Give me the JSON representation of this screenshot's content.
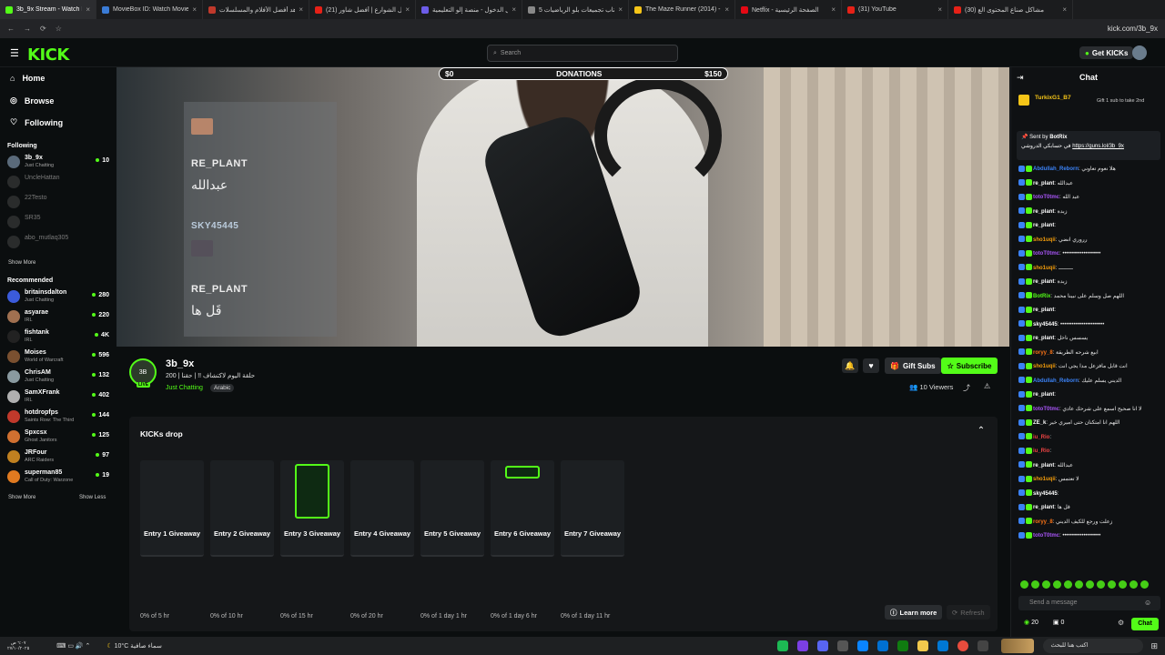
{
  "browser": {
    "tabs": [
      {
        "label": "3b_9x Stream - Watch Live on",
        "color": "#53fc18",
        "active": true
      },
      {
        "label": "MovieBox ID: Watch Movies",
        "color": "#3a7bd5"
      },
      {
        "label": "شاهد أفضل الأفلام والمسلسلات",
        "color": "#c0392b"
      },
      {
        "label": "(21) أكل الشوارع | أفضل شاور",
        "color": "#e62117"
      },
      {
        "label": "تسجيل الدخول - منصة إلو التعليمية",
        "color": "#6c5ce7"
      },
      {
        "label": "كتاب تجميعات بلو الرياضيات 5",
        "color": "#888888"
      },
      {
        "label": "The Maze Runner (2014) - IMDb",
        "color": "#f5c518"
      },
      {
        "label": "Netflix - الصفحة الرئيسية",
        "color": "#e50914"
      },
      {
        "label": "(31) YouTube",
        "color": "#e62117"
      },
      {
        "label": "(30) مشاكل صناع المحتوى الع",
        "color": "#e62117"
      }
    ],
    "url": "kick.com/3b_9x"
  },
  "header": {
    "logo": "KICK",
    "search_placeholder": "Search",
    "get_kicks": "Get KICKs"
  },
  "sidebar": {
    "nav": [
      {
        "label": "Home",
        "icon": "home-icon"
      },
      {
        "label": "Browse",
        "icon": "compass-icon"
      },
      {
        "label": "Following",
        "icon": "heart-icon"
      }
    ],
    "following_title": "Following",
    "following": [
      {
        "name": "3b_9x",
        "category": "Just Chatting",
        "viewers": "10",
        "live": true,
        "color": "#5a6a7a"
      },
      {
        "name": "UncleHattan",
        "category": "",
        "viewers": "",
        "live": false,
        "color": "#4a4a4a"
      },
      {
        "name": "22Testo",
        "category": "",
        "viewers": "",
        "live": false,
        "color": "#4a4a4a"
      },
      {
        "name": "SR35",
        "category": "",
        "viewers": "",
        "live": false,
        "color": "#4a4a4a"
      },
      {
        "name": "abo_mutlaq305",
        "category": "",
        "viewers": "",
        "live": false,
        "color": "#4a4a4a"
      }
    ],
    "show_more": "Show More",
    "recommended_title": "Recommended",
    "recommended": [
      {
        "name": "britainsdalton",
        "category": "Just Chatting",
        "viewers": "280",
        "color": "#3b5bdb"
      },
      {
        "name": "asyarae",
        "category": "IRL",
        "viewers": "220",
        "color": "#a07050"
      },
      {
        "name": "fishtank",
        "category": "IRL",
        "viewers": "4K",
        "color": "#222222"
      },
      {
        "name": "Moises",
        "category": "World of Warcraft",
        "viewers": "596",
        "color": "#7a5030"
      },
      {
        "name": "ChrisAM",
        "category": "Just Chatting",
        "viewers": "132",
        "color": "#8a9aa0"
      },
      {
        "name": "SamXFrank",
        "category": "IRL",
        "viewers": "402",
        "color": "#b0b0b0"
      },
      {
        "name": "hotdropfps",
        "category": "Saints Row: The Third",
        "viewers": "144",
        "color": "#c0392b"
      },
      {
        "name": "Spxcsx",
        "category": "Ghost Janitors",
        "viewers": "125",
        "color": "#d07030"
      },
      {
        "name": "JRFour",
        "category": "ARC Raiders",
        "viewers": "97",
        "color": "#c08020"
      },
      {
        "name": "superman85",
        "category": "Call of Duty: Warzone",
        "viewers": "19",
        "color": "#e07a20"
      }
    ],
    "rec_show_more": "Show More",
    "rec_show_less": "Show Less"
  },
  "video": {
    "donation_min": "$0",
    "donation_label": "DONATIONS",
    "donation_max": "$150",
    "donation_progress": 0,
    "overlay": [
      {
        "name": "RE_PLANT",
        "msg": "عبدالله"
      },
      {
        "name": "SKY45445",
        "msg": ""
      },
      {
        "name": "RE_PLANT",
        "msg": "قَل ها"
      }
    ]
  },
  "channel": {
    "name": "3b_9x",
    "title": "200 | حلقة اليوم لاكتشاف !! | حقنا",
    "category": "Just Chatting",
    "tag": "Arabic",
    "avatar_text": "3B",
    "live_label": "LIVE",
    "gift_subs": "Gift Subs",
    "subscribe": "Subscribe",
    "viewers": "10 Viewers"
  },
  "drop": {
    "title": "KICKs drop",
    "cards": [
      {
        "label": "Entry 1 Giveaway",
        "progress": "0% of 5 hr",
        "image": false
      },
      {
        "label": "Entry 2 Giveaway",
        "progress": "0% of 10 hr",
        "image": false
      },
      {
        "label": "Entry 3 Giveaway",
        "progress": "0% of 15 hr",
        "image": true
      },
      {
        "label": "Entry 4 Giveaway",
        "progress": "0% of 20 hr",
        "image": false
      },
      {
        "label": "Entry 5 Giveaway",
        "progress": "0% of 1 day 1 hr",
        "image": false
      },
      {
        "label": "Entry 6 Giveaway",
        "progress": "0% of 1 day 6 hr",
        "image": true
      },
      {
        "label": "Entry 7 Giveaway",
        "progress": "0% of 1 day 11 hr",
        "image": false
      }
    ],
    "learn_more": "Learn more",
    "refresh": "Refresh"
  },
  "chat": {
    "title": "Chat",
    "gifter_name": "TurkixG1_B7",
    "gifter_note": "Gift 1 sub to take 2nd",
    "pinned_sender": "Sent by",
    "pinned_user": "BotRix",
    "pinned_text": "في حسابكي الدروشي",
    "pinned_link": "https://guns.lol/3b_9x",
    "messages": [
      {
        "user": "Abdullah_Reborn",
        "text": "هلا نعوم تعاوني",
        "color": "#3b82f6"
      },
      {
        "user": "re_plant",
        "text": "عبدالله",
        "color": "#ffffff"
      },
      {
        "user": "totoT0tmc",
        "text": "عبد الله",
        "color": "#a855f7"
      },
      {
        "user": "re_plant",
        "text": "زبدة",
        "color": "#ffffff"
      },
      {
        "user": "re_plant",
        "text": "",
        "color": "#ffffff"
      },
      {
        "user": "sho1uqii",
        "text": "رروري انضي",
        "color": "#f59e0b"
      },
      {
        "user": "totoT0tmc",
        "text": "••••••••••••••••••••",
        "color": "#a855f7"
      },
      {
        "user": "sho1uqii",
        "text": "ـــــــــ",
        "color": "#f59e0b"
      },
      {
        "user": "re_plant",
        "text": "زبدة",
        "color": "#ffffff"
      },
      {
        "user": "BotRix",
        "text": "اللهم صل وسلم على نبينا محمد",
        "color": "#53fc18"
      },
      {
        "user": "re_plant",
        "text": "",
        "color": "#ffffff"
      },
      {
        "user": "sky45445",
        "text": "•••••••••••••••••••••••",
        "color": "#ffffff"
      },
      {
        "user": "re_plant",
        "text": "يسسس ناخل",
        "color": "#ffffff"
      },
      {
        "user": "roryy_8",
        "text": "ابيع شرحه الطريقة",
        "color": "#f97316"
      },
      {
        "user": "sho1uqii",
        "text": "انت قابل مافزعل مدا يجي انت",
        "color": "#f59e0b"
      },
      {
        "user": "Abdullah_Reborn",
        "text": "الديني يسلم عليك",
        "color": "#3b82f6"
      },
      {
        "user": "re_plant",
        "text": "",
        "color": "#ffffff"
      },
      {
        "user": "totoT0tmc",
        "text": "لا انا صحيح اسمع على شرحك عادي",
        "color": "#a855f7"
      },
      {
        "user": "ZE_k",
        "text": "اللهم انا امتكنان حتى اميري خير",
        "color": "#ffffff"
      },
      {
        "user": "iu_Rio",
        "text": "",
        "color": "#ef4444"
      },
      {
        "user": "iu_Rio",
        "text": "",
        "color": "#ef4444"
      },
      {
        "user": "re_plant",
        "text": "عبدالله",
        "color": "#ffffff"
      },
      {
        "user": "sho1uqii",
        "text": "لا تعتمس",
        "color": "#f59e0b"
      },
      {
        "user": "sky45445",
        "text": "",
        "color": "#ffffff"
      },
      {
        "user": "re_plant",
        "text": "قل ها",
        "color": "#ffffff"
      },
      {
        "user": "roryy_8",
        "text": "زعلت ورجع للكيف الديني",
        "color": "#f97316"
      },
      {
        "user": "totoT0tmc",
        "text": "••••••••••••••••••••",
        "color": "#a855f7"
      }
    ],
    "input_placeholder": "Send a message",
    "kicks_count": "20",
    "gifts_count": "0",
    "chat_button": "Chat"
  },
  "taskbar": {
    "weather": "10°C  سماء صافية",
    "time": "٦:٠٧ ص",
    "date": "٢٧/١٠/٢٠٢٥",
    "search": "اكتب هنا للبحث"
  }
}
